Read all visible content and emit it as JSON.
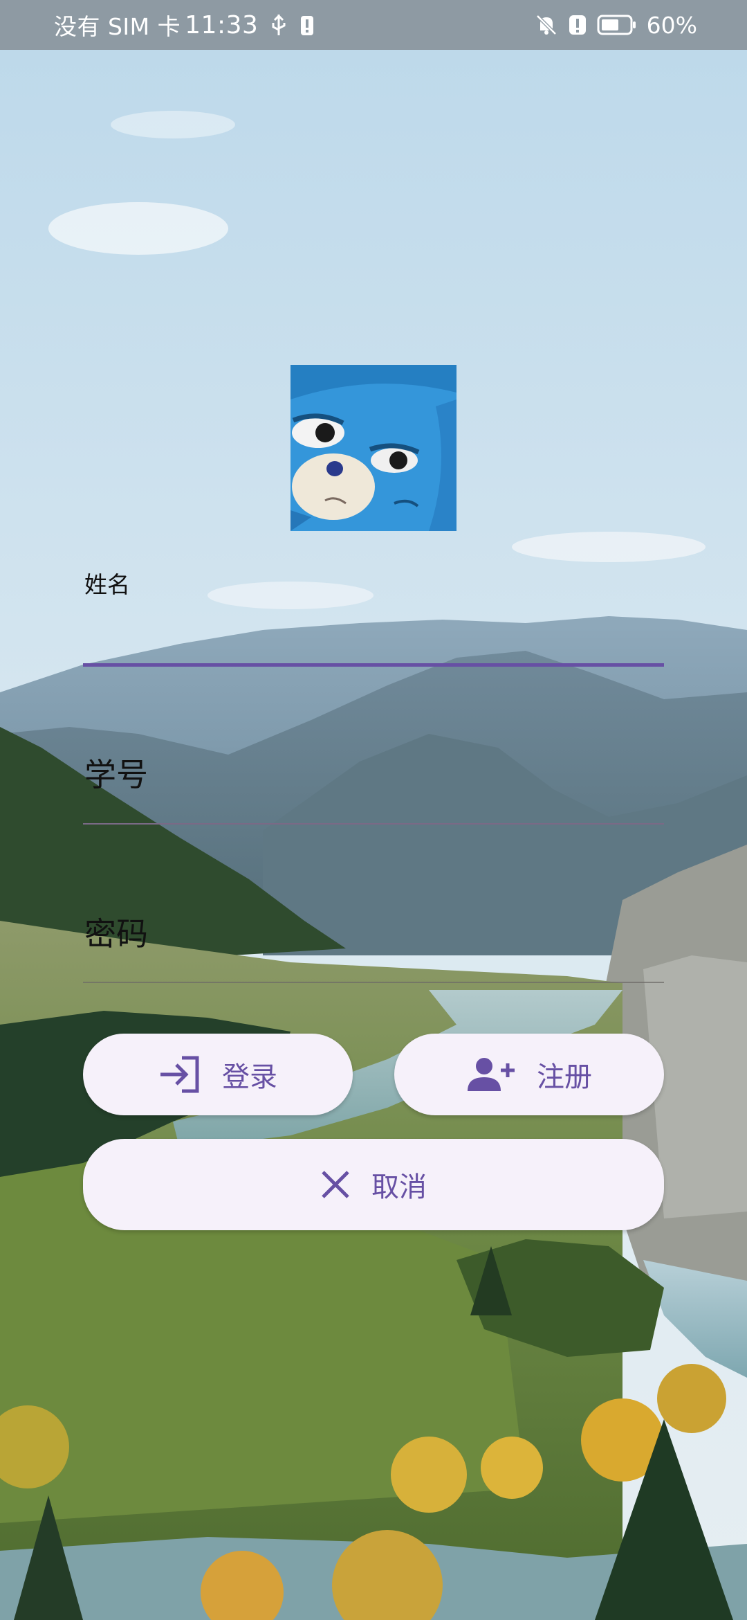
{
  "status_bar": {
    "carrier": "没有 SIM 卡",
    "time": "11:33",
    "battery": "60%",
    "icons": [
      "usb-icon",
      "alert-icon",
      "mute-bell-icon",
      "alert-icon",
      "battery-icon"
    ]
  },
  "form": {
    "name_label": "姓名",
    "student_id_label": "学号",
    "password_label": "密码",
    "name_value": "",
    "accent_color": "#6750a4"
  },
  "buttons": {
    "login_label": "登录",
    "register_label": "注册",
    "cancel_label": "取消"
  }
}
